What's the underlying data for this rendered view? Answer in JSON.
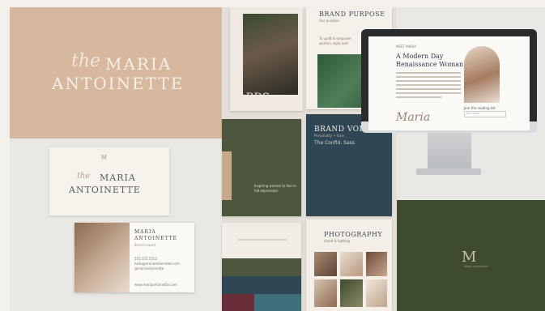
{
  "brand": {
    "the": "the",
    "maria": "MARIA",
    "antoinette": "ANTOINETTE"
  },
  "business_card": {
    "monogram": "M",
    "name_line1": "MARIA",
    "name_line2": "ANTOINETTE",
    "role": "Brand expert",
    "contact1": "555.555.5555",
    "contact2": "hello@mariaantoinette.com",
    "contact3": "@mariaantoinette",
    "website": "www.mariaantoinette.com"
  },
  "collage": {
    "brand_standards_l1": "D",
    "brand_standards_l2": "DARDS",
    "brand_purpose_title": "BRAND PURPOSE",
    "brand_purpose_sub": "Our purpose",
    "brand_purpose_body1": "To uplift & empower",
    "brand_purpose_body2": "women, style and",
    "green_text1": "Inspiring women to live in",
    "green_text2": "full expression",
    "brand_voice_title": "BRAND VOICE",
    "brand_voice_sub": "Personality + tone",
    "brand_voice_text": "The Confid. Sass",
    "photography_title": "PHOTOGRAPHY",
    "photography_sub": "mood & lighting"
  },
  "screen": {
    "label": "MEET MARIA",
    "heading1": "A Modern Day",
    "heading2": "Renaissance Woman",
    "signature": "Maria",
    "join": "Join the reading list",
    "email_placeholder": "Your email"
  },
  "green_panel": {
    "logo": "M",
    "sub": "MARIA ANTOINETTE"
  },
  "colors": {
    "tan": "#d7b79e",
    "forest": "#4d573d",
    "navy": "#2f4754",
    "wine": "#6b2d3a",
    "teal": "#3f6f7a",
    "dark_green": "#3e4b2c"
  }
}
